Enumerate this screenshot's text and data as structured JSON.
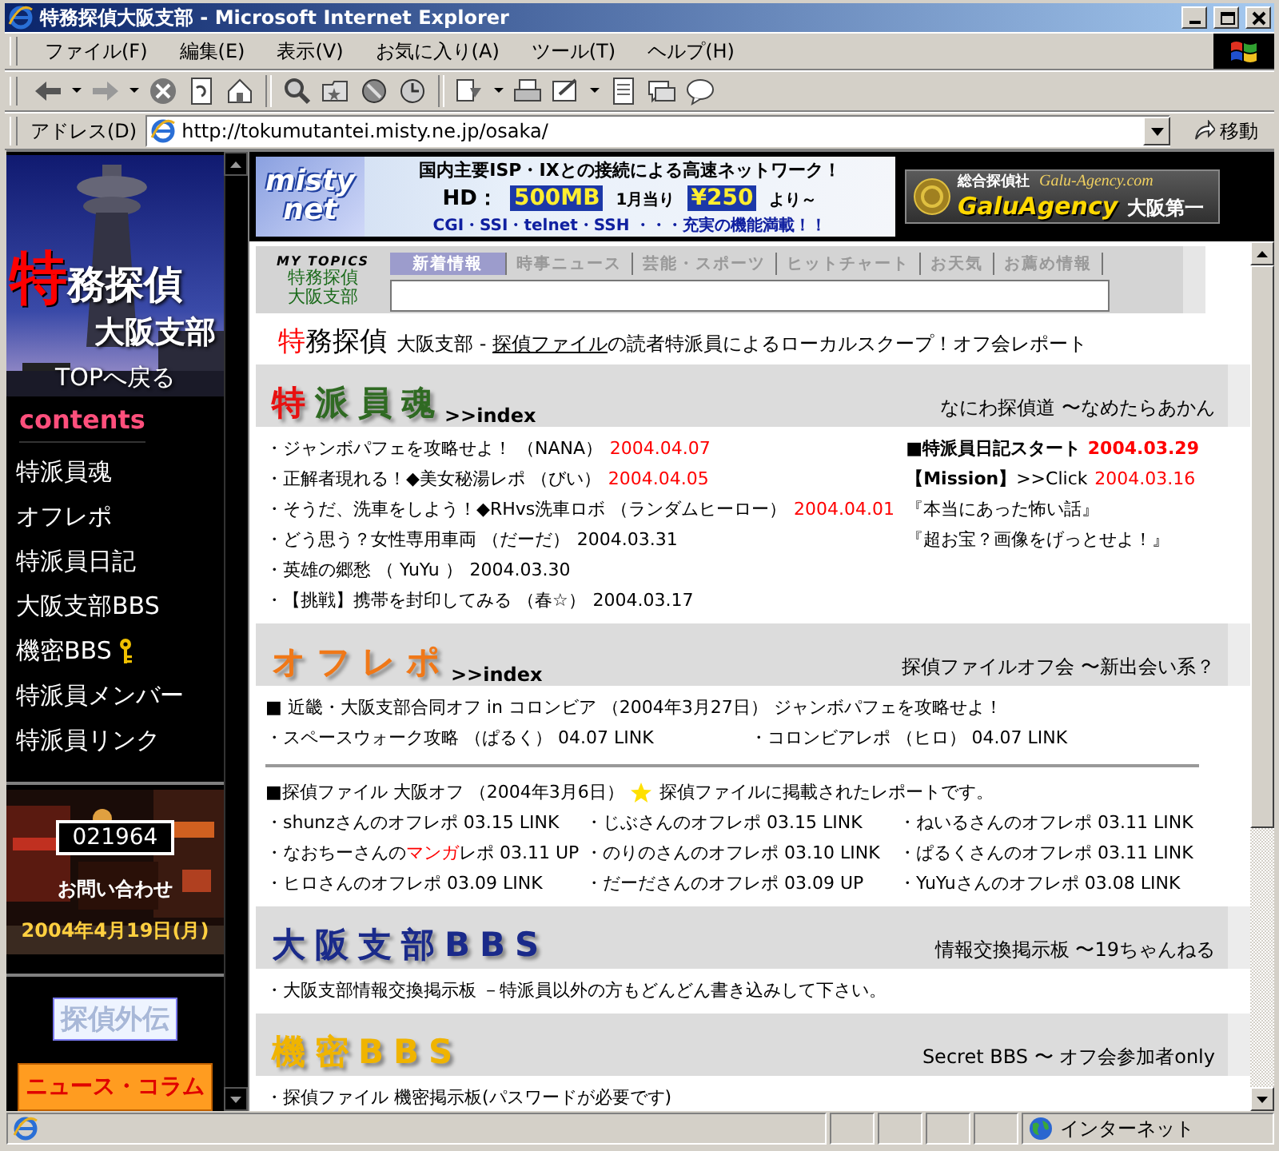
{
  "window": {
    "title": "特務探偵大阪支部 - Microsoft Internet Explorer"
  },
  "menu_bar": [
    "ファイル(F)",
    "編集(E)",
    "表示(V)",
    "お気に入り(A)",
    "ツール(T)",
    "ヘルプ(H)"
  ],
  "address_bar": {
    "label": "アドレス(D)",
    "value": "http://tokumutantei.misty.ne.jp/osaka/",
    "go_button": "移動"
  },
  "sidebar": {
    "logo": {
      "first": "特",
      "rest": "務探偵",
      "branch": "大阪支部",
      "top_link": "TOPへ戻る"
    },
    "contents_heading": "contents",
    "items": [
      {
        "label": "特派員魂",
        "locked": false
      },
      {
        "label": "オフレポ",
        "locked": false
      },
      {
        "label": "特派員日記",
        "locked": false
      },
      {
        "label": "大阪支部BBS",
        "locked": false
      },
      {
        "label": "機密BBS",
        "locked": true
      },
      {
        "label": "特派員メンバー",
        "locked": false
      },
      {
        "label": "特派員リンク",
        "locked": false
      }
    ],
    "counter": "021964",
    "contact": "お問い合わせ",
    "date": "2004年4月19日(月)",
    "buttons": [
      {
        "label": "探偵外伝",
        "kind": "outline"
      },
      {
        "label": "ニュース・コラム",
        "kind": "solid"
      }
    ]
  },
  "banners": {
    "misty": {
      "logo_lines": [
        "misty",
        "net"
      ],
      "headline": "国内主要ISP・IXとの接続による高速ネットワーク！",
      "hd_label": "HD：",
      "hd_value": "500MB",
      "price_label": "1月当り",
      "price": "¥250",
      "price_suffix": "より～",
      "features": "CGI・SSI・telnet・SSH ・・・充実の機能満載！！"
    },
    "galu": {
      "company": "総合探偵社",
      "url": "Galu-Agency.com",
      "name": "GaluAgency",
      "branch": "大阪第一"
    }
  },
  "my_topics": {
    "label": "MY TOPICS",
    "name_lines": [
      "特務探偵",
      "大阪支部"
    ],
    "tabs": [
      {
        "label": "新着情報",
        "selected": true
      },
      {
        "label": "時事ニュース",
        "selected": false
      },
      {
        "label": "芸能・スポーツ",
        "selected": false
      },
      {
        "label": "ヒットチャート",
        "selected": false
      },
      {
        "label": "お天気",
        "selected": false
      },
      {
        "label": "お薦め情報",
        "selected": false
      }
    ]
  },
  "tagline": {
    "first": "特",
    "rest": "務探偵",
    "before": "大阪支部 - ",
    "link": "探偵ファイル",
    "after": "の読者特派員によるローカルスクープ！オフ会レポート"
  },
  "sections": [
    {
      "kind": "news",
      "title": "特派員魂",
      "color": "#2f6a22",
      "accent_first": true,
      "index_link": ">>index",
      "subtitle": "なにわ探偵道 〜なめたらあかん",
      "entries": [
        {
          "text": "・ジャンボパフェを攻略せよ！ （NANA）",
          "date": "2004.04.07",
          "recent": true
        },
        {
          "text": "・正解者現れる！◆美女秘湯レポ （びい）",
          "date": "2004.04.05",
          "recent": true
        },
        {
          "text": "・そうだ、洗車をしよう！◆RHvs洗車ロボ （ランダムヒーロー）",
          "date": "2004.04.01",
          "recent": true
        },
        {
          "text": "・どう思う？女性専用車両 （だーだ）",
          "date": "2004.03.31",
          "recent": false
        },
        {
          "text": "・英雄の郷愁 （ YuYu ）",
          "date": "2004.03.30",
          "recent": false
        },
        {
          "text": "・【挑戦】携帯を封印してみる （春☆）",
          "date": "2004.03.17",
          "recent": false
        }
      ],
      "side_entries": [
        {
          "kind": "headline",
          "text": "■特派員日記スタート",
          "date": "2004.03.29",
          "recent": true
        },
        {
          "kind": "plain",
          "text": "**【Mission】**>>Click",
          "date": "2004.03.16",
          "recent": true
        },
        {
          "kind": "plain",
          "text": "『本当にあった怖い話』"
        },
        {
          "kind": "plain",
          "text": "『超お宝？画像をげっとせよ！』"
        }
      ]
    },
    {
      "kind": "offreport",
      "title": "オフレポ",
      "color": "#f07818",
      "index_link": ">>index",
      "subtitle": "探偵ファイルオフ会 〜新出会い系？",
      "event": "■ 近畿・大阪支部合同オフ in コロンビア （2004年3月27日） ジャンボパフェを攻略せよ！",
      "event_links": [
        "・スペースウォーク攻略 （ぱるく） 04.07 LINK",
        "・コロンビアレポ （ヒロ） 04.07 LINK"
      ],
      "heading": "■探偵ファイル 大阪オフ （2004年3月6日）",
      "note": "探偵ファイルに掲載されたレポートです。",
      "reports": [
        {
          "text": "・shunzさんのオフレポ 03.15 LINK"
        },
        {
          "text": "・じぶさんのオフレポ 03.15 LINK"
        },
        {
          "text": "・ねいるさんのオフレポ 03.11 LINK"
        },
        {
          "before": "・なおちーさんの",
          "highlight": "マンガ",
          "after": "レポ 03.11 UP"
        },
        {
          "text": "・のりのさんのオフレポ 03.10 LINK"
        },
        {
          "text": "・ぱるくさんのオフレポ 03.11 LINK"
        },
        {
          "text": "・ヒロさんのオフレポ 03.09 LINK"
        },
        {
          "text": "・だーださんのオフレポ 03.09 UP"
        },
        {
          "text": "・YuYuさんのオフレポ 03.08 LINK"
        }
      ]
    },
    {
      "kind": "plain",
      "title": "大阪支部BBS",
      "color": "#1a2a8a",
      "subtitle": "情報交換掲示板 〜19ちゃんねる",
      "lines": [
        "・大阪支部情報交換掲示板 －特派員以外の方もどんどん書き込みして下さい。"
      ]
    },
    {
      "kind": "plain",
      "title": "機密BBS",
      "color": "#f0b400",
      "subtitle": "Secret BBS 〜 オフ会参加者only",
      "lines": [
        "・探偵ファイル 機密掲示板(パスワードが必要です)"
      ]
    }
  ],
  "status_bar": {
    "zone": "インターネット"
  }
}
